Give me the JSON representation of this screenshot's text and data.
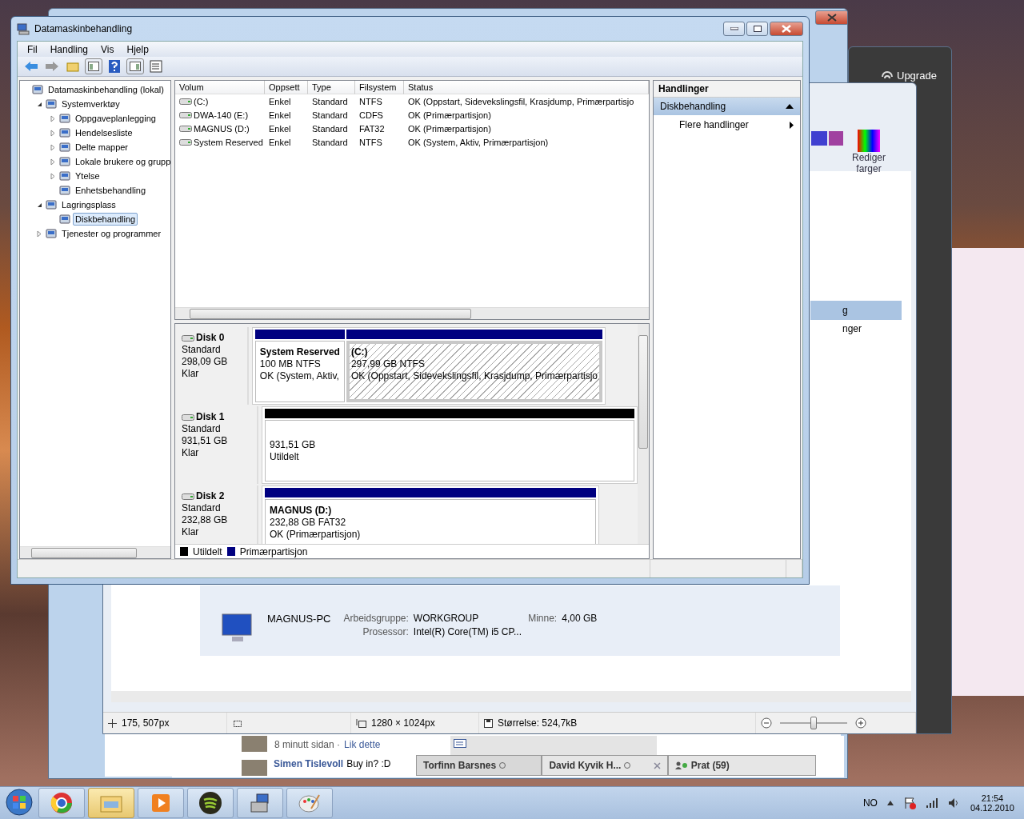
{
  "main_window": {
    "title": "Datamaskinbehandling",
    "menu": [
      "Fil",
      "Handling",
      "Vis",
      "Hjelp"
    ],
    "tree": [
      {
        "label": "Datamaskinbehandling (lokal)",
        "expandable": false,
        "selected": false,
        "children": [
          {
            "label": "Systemverktøy",
            "expandable": true,
            "expanded": true,
            "selected": false,
            "children": [
              {
                "label": "Oppgaveplanlegging",
                "expandable": true,
                "expanded": false,
                "selected": false
              },
              {
                "label": "Hendelsesliste",
                "expandable": true,
                "expanded": false,
                "selected": false
              },
              {
                "label": "Delte mapper",
                "expandable": true,
                "expanded": false,
                "selected": false
              },
              {
                "label": "Lokale brukere og grupp",
                "expandable": true,
                "expanded": false,
                "selected": false
              },
              {
                "label": "Ytelse",
                "expandable": true,
                "expanded": false,
                "selected": false
              },
              {
                "label": "Enhetsbehandling",
                "expandable": false,
                "selected": false
              }
            ]
          },
          {
            "label": "Lagringsplass",
            "expandable": true,
            "expanded": true,
            "selected": false,
            "children": [
              {
                "label": "Diskbehandling",
                "expandable": false,
                "selected": true
              }
            ]
          },
          {
            "label": "Tjenester og programmer",
            "expandable": true,
            "expanded": false,
            "selected": false
          }
        ]
      }
    ],
    "volumes": {
      "columns": [
        "Volum",
        "Oppsett",
        "Type",
        "Filsystem",
        "Status"
      ],
      "rows": [
        {
          "cells": [
            "(C:)",
            "Enkel",
            "Standard",
            "NTFS",
            "OK (Oppstart, Sidevekslingsfil, Krasjdump, Primærpartisjo"
          ]
        },
        {
          "cells": [
            "DWA-140 (E:)",
            "Enkel",
            "Standard",
            "CDFS",
            "OK (Primærpartisjon)"
          ]
        },
        {
          "cells": [
            "MAGNUS (D:)",
            "Enkel",
            "Standard",
            "FAT32",
            "OK (Primærpartisjon)"
          ]
        },
        {
          "cells": [
            "System Reserved",
            "Enkel",
            "Standard",
            "NTFS",
            "OK (System, Aktiv, Primærpartisjon)"
          ]
        }
      ]
    },
    "disks": [
      {
        "name": "Disk 0",
        "type": "Standard",
        "size": "298,09 GB",
        "state": "Klar",
        "partitions": [
          {
            "kind": "primary",
            "name": "System Reserved",
            "size": "100 MB NTFS",
            "status": "OK (System, Aktiv,",
            "selected": false
          },
          {
            "kind": "primary",
            "name": "(C:)",
            "size": "297,99 GB NTFS",
            "status": "OK (Oppstart, Sidevekslingsfil, Krasjdump, Primærpartisjo",
            "selected": true
          }
        ]
      },
      {
        "name": "Disk 1",
        "type": "Standard",
        "size": "931,51 GB",
        "state": "Klar",
        "partitions": [
          {
            "kind": "unallocated",
            "size": "931,51 GB",
            "status": "Utildelt",
            "selected": false
          }
        ]
      },
      {
        "name": "Disk 2",
        "type": "Standard",
        "size": "232,88 GB",
        "state": "Klar",
        "partitions": [
          {
            "kind": "primary",
            "name": "MAGNUS  (D:)",
            "size": "232,88 GB FAT32",
            "status": "OK (Primærpartisjon)",
            "selected": false
          }
        ]
      }
    ],
    "legend": [
      {
        "label": "Utildelt",
        "color": "#000000"
      },
      {
        "label": "Primærpartisjon",
        "color": "#000080"
      }
    ],
    "actions": {
      "title": "Handlinger",
      "section": "Diskbehandling",
      "items": [
        "Flere handlinger"
      ]
    }
  },
  "viewer": {
    "status": [
      "175, 507px",
      "1280 × 1024px",
      "Størrelse: 524,7kB"
    ],
    "zoom": {
      "level": 0.5
    }
  },
  "system_info": {
    "computer": "MAGNUS-PC",
    "workgroup_label": "Arbeidsgruppe:",
    "workgroup": "WORKGROUP",
    "memory_label": "Minne:",
    "memory": "4,00 GB",
    "cpu_label": "Prosessor:",
    "cpu": "Intel(R) Core(TM) i5 CP..."
  },
  "paint": {
    "edit_colors": "Rediger farger",
    "fragments": [
      "g",
      "nger"
    ]
  },
  "music_app": {
    "upgrade": "Upgrade"
  },
  "social": {
    "meta": "8 minutt sidan ·",
    "like": "Lik dette",
    "author": "Simen Tislevoll",
    "message": "Buy in? :D",
    "chats": [
      {
        "name": "Torfinn Barsnes",
        "closable": false
      },
      {
        "name": "David Kyvik H...",
        "closable": true
      }
    ],
    "chat_button": "Prat (59)"
  },
  "taskbar": {
    "apps": [
      {
        "kind": "browser",
        "selected": false
      },
      {
        "kind": "folder",
        "selected": true
      },
      {
        "kind": "media",
        "selected": false
      },
      {
        "kind": "music",
        "selected": false
      },
      {
        "kind": "computer",
        "selected": false
      },
      {
        "kind": "paint",
        "selected": false
      }
    ],
    "language": "NO",
    "time": "21:54",
    "date": "04.12.2010"
  }
}
